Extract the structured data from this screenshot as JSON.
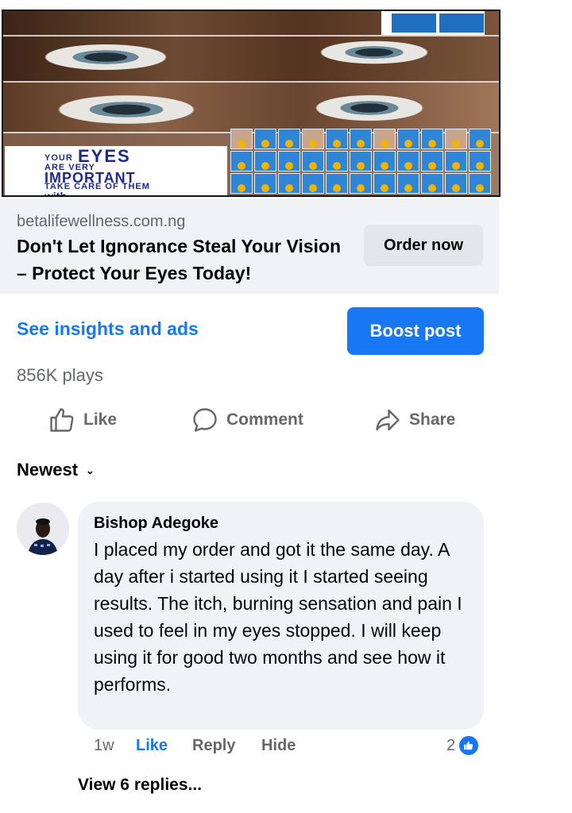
{
  "ad": {
    "banner": {
      "line1_small": "YOUR",
      "line1_big": "EYES",
      "line2": "ARE VERY",
      "line3": "IMPORTANT",
      "line4": "TAKE CARE OF THEM",
      "line5": "with..."
    },
    "domain": "betalifewellness.com.ng",
    "title": "Don't Let Ignorance Steal Your Vision – Protect Your Eyes Today!",
    "cta_label": "Order now"
  },
  "post_actions": {
    "insights_label": "See insights and ads",
    "boost_label": "Boost post",
    "plays": "856K plays",
    "like_label": "Like",
    "comment_label": "Comment",
    "share_label": "Share"
  },
  "comments": {
    "sort_label": "Newest",
    "items": [
      {
        "author": "Bishop Adegoke",
        "text": "I placed my order and got it the same day. A day after i started using it I started seeing results. The itch, burning sensation and pain I used to feel in my eyes stopped. I will keep using it for good two months and see how  it performs.",
        "time": "1w",
        "like_label": "Like",
        "reply_label": "Reply",
        "hide_label": "Hide",
        "reaction_count": "2"
      }
    ],
    "view_replies_label": "View 6 replies..."
  },
  "colors": {
    "accent": "#1877f2",
    "muted_text": "#65676b",
    "bubble": "#f0f2f5"
  },
  "icons": [
    "thumbs-up-icon",
    "comment-bubble-icon",
    "share-arrow-icon",
    "chevron-down-icon",
    "like-reaction-icon"
  ]
}
